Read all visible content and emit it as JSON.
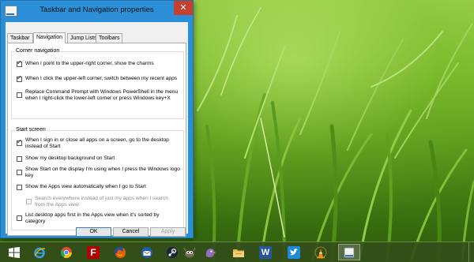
{
  "window": {
    "title": "Taskbar and Navigation properties",
    "close_symbol": "✕"
  },
  "tabs": [
    {
      "label": "Taskbar",
      "active": false
    },
    {
      "label": "Navigation",
      "active": true
    },
    {
      "label": "Jump Lists",
      "active": false
    },
    {
      "label": "Toolbars",
      "active": false
    }
  ],
  "corner_navigation": {
    "title": "Corner navigation",
    "options": [
      {
        "label": "When I point to the upper-right corner, show the charms",
        "checked": true,
        "enabled": true
      },
      {
        "label": "When I click the upper-left corner, switch between my recent apps",
        "checked": true,
        "enabled": true
      },
      {
        "label": "Replace Command Prompt with Windows PowerShell in the menu when I right-click the lower-left corner or press Windows key+X",
        "checked": false,
        "enabled": true
      }
    ]
  },
  "start_screen": {
    "title": "Start screen",
    "options": [
      {
        "label": "When I sign in or close all apps on a screen, go to the desktop instead of Start",
        "checked": true,
        "enabled": true
      },
      {
        "label": "Show my desktop background on Start",
        "checked": false,
        "enabled": true
      },
      {
        "label": "Show Start on the display I'm using when I press the Windows logo key",
        "checked": false,
        "enabled": true
      },
      {
        "label": "Show the Apps view automatically when I go to Start",
        "checked": false,
        "enabled": true
      },
      {
        "label": "Search everywhere instead of just my apps when I search from the Apps view",
        "checked": false,
        "enabled": false
      },
      {
        "label": "List desktop apps first in the Apps view when it's sorted by category",
        "checked": false,
        "enabled": true
      }
    ]
  },
  "buttons": {
    "ok": "OK",
    "cancel": "Cancel",
    "apply": "Apply"
  },
  "taskbar": {
    "apps": [
      {
        "name": "windows-logo-icon",
        "active": false
      },
      {
        "name": "internet-explorer-icon",
        "active": false
      },
      {
        "name": "chrome-icon",
        "active": false
      },
      {
        "name": "filezilla-icon",
        "active": false
      },
      {
        "name": "firefox-icon",
        "active": false
      },
      {
        "name": "thunderbird-icon",
        "active": false
      },
      {
        "name": "steam-icon",
        "active": false
      },
      {
        "name": "gimp-icon",
        "active": false
      },
      {
        "name": "pidgin-icon",
        "active": false
      },
      {
        "name": "file-explorer-icon",
        "active": false
      },
      {
        "name": "word-icon",
        "active": false
      },
      {
        "name": "twitter-icon",
        "active": false
      },
      {
        "name": "vlc-icon",
        "active": false
      },
      {
        "name": "taskbar-properties-icon",
        "active": true
      }
    ],
    "labels": {
      "filezilla": "F",
      "word": "W"
    }
  },
  "colors": {
    "window_frame": "#2a8fd6",
    "close_button": "#c7402f",
    "taskbar": "#344e1a"
  }
}
